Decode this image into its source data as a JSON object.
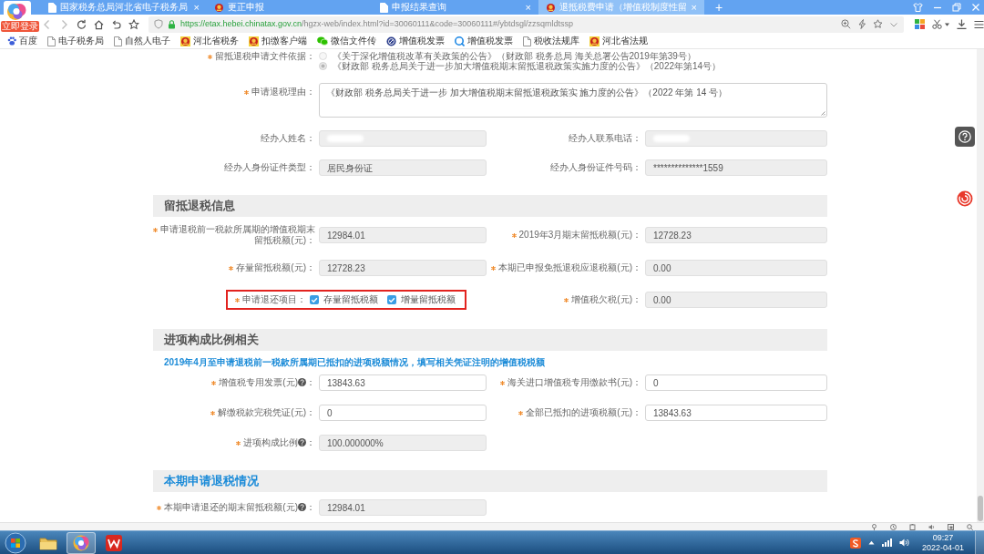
{
  "browser": {
    "login_badge": "立即登录",
    "tabs": [
      {
        "kind": "page",
        "title": "国家税务总局河北省电子税务局",
        "close": "×",
        "selected": false
      },
      {
        "kind": "emblem",
        "title": "更正申报",
        "selected": false
      },
      {
        "kind": "page",
        "title": "申报结果查询",
        "close": "×",
        "selected": false
      },
      {
        "kind": "emblem",
        "title": "退抵税费申请（增值税制度性留",
        "close": "×",
        "selected": true
      }
    ],
    "new_tab": "+",
    "address": {
      "host": "https://etax.hebei.chinatax.gov.cn",
      "path": "/hgzx-web/index.html?id=30060111&code=30060111#/ybtdsgl/zzsqmldtssp"
    },
    "bookmarks": [
      {
        "kind": "paw",
        "label": "百度"
      },
      {
        "kind": "page",
        "label": "电子税务局"
      },
      {
        "kind": "page",
        "label": "自然人电子"
      },
      {
        "kind": "emblem",
        "label": "河北省税务"
      },
      {
        "kind": "emblem",
        "label": "扣缴客户端"
      },
      {
        "kind": "chat",
        "label": "微信文件传"
      },
      {
        "kind": "disc",
        "label": "增值税发票"
      },
      {
        "kind": "magnifier",
        "label": "增值税发票"
      },
      {
        "kind": "page",
        "label": "税收法规库"
      },
      {
        "kind": "emblem",
        "label": "河北省法规"
      }
    ]
  },
  "form": {
    "basis": {
      "label": "留抵退税申请文件依据：",
      "required": true,
      "options": [
        {
          "text": "《关于深化增值税改革有关政策的公告》（财政部 税务总局 海关总署公告2019年第39号）",
          "selected": false
        },
        {
          "text": "《财政部 税务总局关于进一步加大增值税期末留抵退税政策实施力度的公告》（2022年第14号）",
          "selected": true
        }
      ]
    },
    "reason": {
      "label": "申请退税理由：",
      "required": true,
      "value": "《财政部 税务总局关于进一步 加大增值税期末留抵退税政策实 施力度的公告》（2022 年第 14 号）"
    },
    "rows": [
      [
        {
          "kind": "input",
          "label": "经办人姓名：",
          "required": false,
          "editable": false,
          "redacted": true
        },
        {
          "kind": "input",
          "label": "经办人联系电话：",
          "required": false,
          "editable": false,
          "redacted": true
        }
      ],
      [
        {
          "kind": "input",
          "label": "经办人身份证件类型：",
          "required": false,
          "editable": false,
          "value": "居民身份证"
        },
        {
          "kind": "input",
          "label": "经办人身份证件号码：",
          "required": false,
          "editable": false,
          "value": "**************1559"
        }
      ]
    ]
  },
  "sections": [
    {
      "title": "留抵退税信息",
      "active": false,
      "rows": [
        [
          {
            "kind": "input",
            "label": "申请退税前一税款所属期的增值税期末留抵税额(元)：",
            "required": true,
            "editable": false,
            "value": "12984.01"
          },
          {
            "kind": "input",
            "label": "2019年3月期末留抵税额(元)：",
            "required": true,
            "editable": false,
            "value": "12728.23"
          }
        ],
        [
          {
            "kind": "input",
            "label": "存量留抵税额(元)：",
            "required": true,
            "editable": false,
            "value": "12728.23"
          },
          {
            "kind": "input",
            "label": "本期已申报免抵退税应退税额(元)：",
            "required": true,
            "editable": false,
            "value": "0.00"
          }
        ],
        [
          {
            "kind": "checkboxes",
            "label": "申请退还项目：",
            "required": true,
            "highlighted": true,
            "options": [
              {
                "label": "存量留抵税额",
                "checked": true
              },
              {
                "label": "增量留抵税额",
                "checked": true
              }
            ]
          },
          {
            "kind": "input",
            "label": "增值税欠税(元)：",
            "required": true,
            "editable": false,
            "value": "0.00"
          }
        ]
      ]
    },
    {
      "title": "进项构成比例相关",
      "active": false,
      "note": "2019年4月至申请退税前一税款所属期已抵扣的进项税额情况，填写相关凭证注明的增值税税额",
      "rows": [
        [
          {
            "kind": "input",
            "label": "增值税专用发票(元)",
            "help": true,
            "suffix": "：",
            "required": true,
            "editable": true,
            "value": "13843.63"
          },
          {
            "kind": "input",
            "label": "海关进口增值税专用缴款书(元)：",
            "required": true,
            "editable": true,
            "value": "0"
          }
        ],
        [
          {
            "kind": "input",
            "label": "解缴税款完税凭证(元)：",
            "required": true,
            "editable": true,
            "value": "0"
          },
          {
            "kind": "input",
            "label": "全部已抵扣的进项税额(元)：",
            "required": true,
            "editable": true,
            "value": "13843.63"
          }
        ],
        [
          {
            "kind": "input",
            "label": "进项构成比例",
            "help": true,
            "suffix": "：",
            "required": true,
            "editable": false,
            "value": "100.000000%"
          }
        ]
      ]
    },
    {
      "title": "本期申请退税情况",
      "active": true,
      "rows": [
        [
          {
            "kind": "input",
            "label": "本期申请退还的期末留抵税额(元)",
            "help": true,
            "suffix": "：",
            "required": true,
            "editable": false,
            "value": "12984.01"
          }
        ]
      ]
    }
  ],
  "taskbar": {
    "apps": [
      {
        "kind": "folder",
        "selected": false
      },
      {
        "kind": "browser",
        "selected": true
      },
      {
        "kind": "office",
        "selected": false
      }
    ],
    "time": "09:27",
    "date": "2022-04-01"
  }
}
